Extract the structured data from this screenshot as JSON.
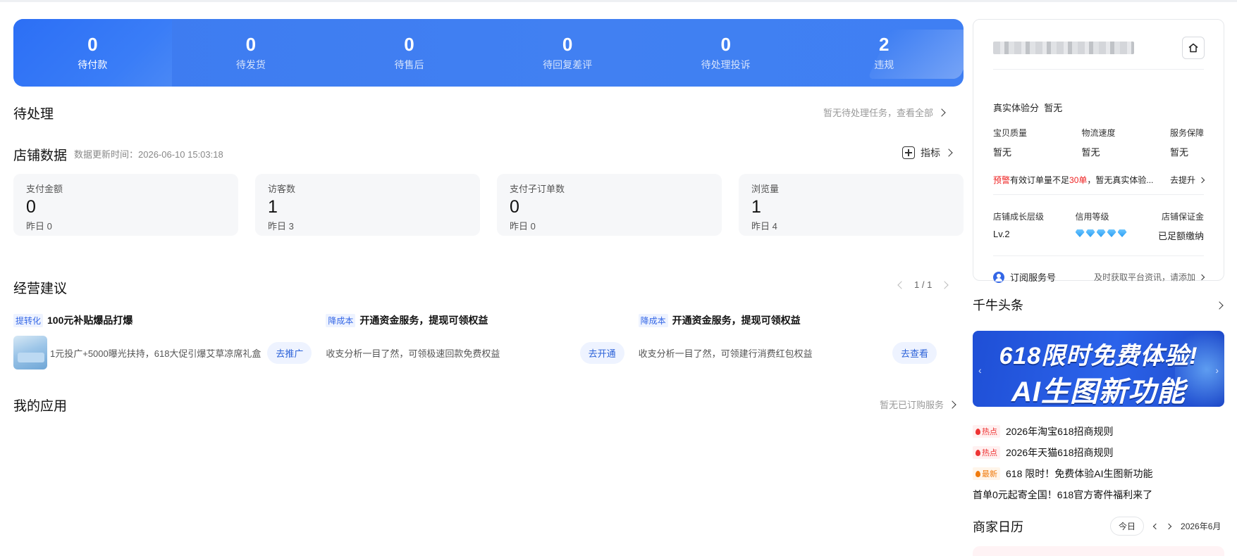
{
  "order_stats": [
    {
      "value": "0",
      "label": "待付款"
    },
    {
      "value": "0",
      "label": "待发货"
    },
    {
      "value": "0",
      "label": "待售后"
    },
    {
      "value": "0",
      "label": "待回复差评"
    },
    {
      "value": "0",
      "label": "待处理投诉"
    },
    {
      "value": "2",
      "label": "违规"
    }
  ],
  "pending": {
    "title": "待处理",
    "link": "暂无待处理任务，查看全部"
  },
  "store_data": {
    "title": "店铺数据",
    "update_time": "数据更新时间：2026-06-10 15:03:18",
    "metric_link": "指标",
    "cards": [
      {
        "title": "支付金额",
        "value": "0",
        "yesterday": "昨日 0"
      },
      {
        "title": "访客数",
        "value": "1",
        "yesterday": "昨日 3"
      },
      {
        "title": "支付子订单数",
        "value": "0",
        "yesterday": "昨日 0"
      },
      {
        "title": "浏览量",
        "value": "1",
        "yesterday": "昨日 4"
      }
    ]
  },
  "suggestions": {
    "title": "经营建议",
    "pager": "1 / 1",
    "items": [
      {
        "tag": "提转化",
        "title": "100元补贴爆品打爆",
        "desc": "1元投广+5000曝光扶持，618大促引爆艾草凉席礼盒",
        "button": "去推广",
        "has_thumb": true
      },
      {
        "tag": "降成本",
        "title": "开通资金服务，提现可领权益",
        "desc": "收支分析一目了然，可领极速回款免费权益",
        "button": "去开通",
        "has_thumb": false
      },
      {
        "tag": "降成本",
        "title": "开通资金服务，提现可领权益",
        "desc": "收支分析一目了然，可领建行消费红包权益",
        "button": "去查看",
        "has_thumb": false
      }
    ]
  },
  "my_apps": {
    "title": "我的应用",
    "link": "暂无已订购服务"
  },
  "profile": {
    "score_label": "真实体验分",
    "score_value": "暂无",
    "metrics": [
      {
        "label": "宝贝质量",
        "value": "暂无"
      },
      {
        "label": "物流速度",
        "value": "暂无"
      },
      {
        "label": "服务保障",
        "value": "暂无"
      }
    ],
    "warning": {
      "tag": "预警",
      "text_a": "有效订单量不足",
      "highlight": "30单",
      "text_b": "，暂无真实体验...",
      "action": "去提升"
    },
    "levels": [
      {
        "label": "店铺成长层级",
        "value": "Lv.2"
      },
      {
        "label": "信用等级",
        "diamonds": 5
      },
      {
        "label": "店铺保证金",
        "value": "已足额缴纳"
      }
    ],
    "subscribe": {
      "label": "订阅服务号",
      "hint": "及时获取平台资讯，请添加"
    }
  },
  "qianniu": {
    "title": "千牛头条",
    "banner_line1": "618限时免费体验!",
    "banner_line2": "AI生图新功能",
    "news": [
      {
        "badge": "热点",
        "text": "2026年淘宝618招商规则"
      },
      {
        "badge": "热点",
        "text": "2026年天猫618招商规则"
      },
      {
        "badge": "最新",
        "text": "618 限时！免费体验AI生图新功能"
      },
      {
        "badge": "",
        "text": "首单0元起寄全国！618官方寄件福利来了"
      }
    ]
  },
  "calendar": {
    "title": "商家日历",
    "today": "今日",
    "month": "2026年6月"
  },
  "colors": {
    "banner_blue": "#3d7bf0",
    "accent_blue": "#3366e6",
    "warning_red": "#e22222",
    "success_green": "#21b36b"
  }
}
